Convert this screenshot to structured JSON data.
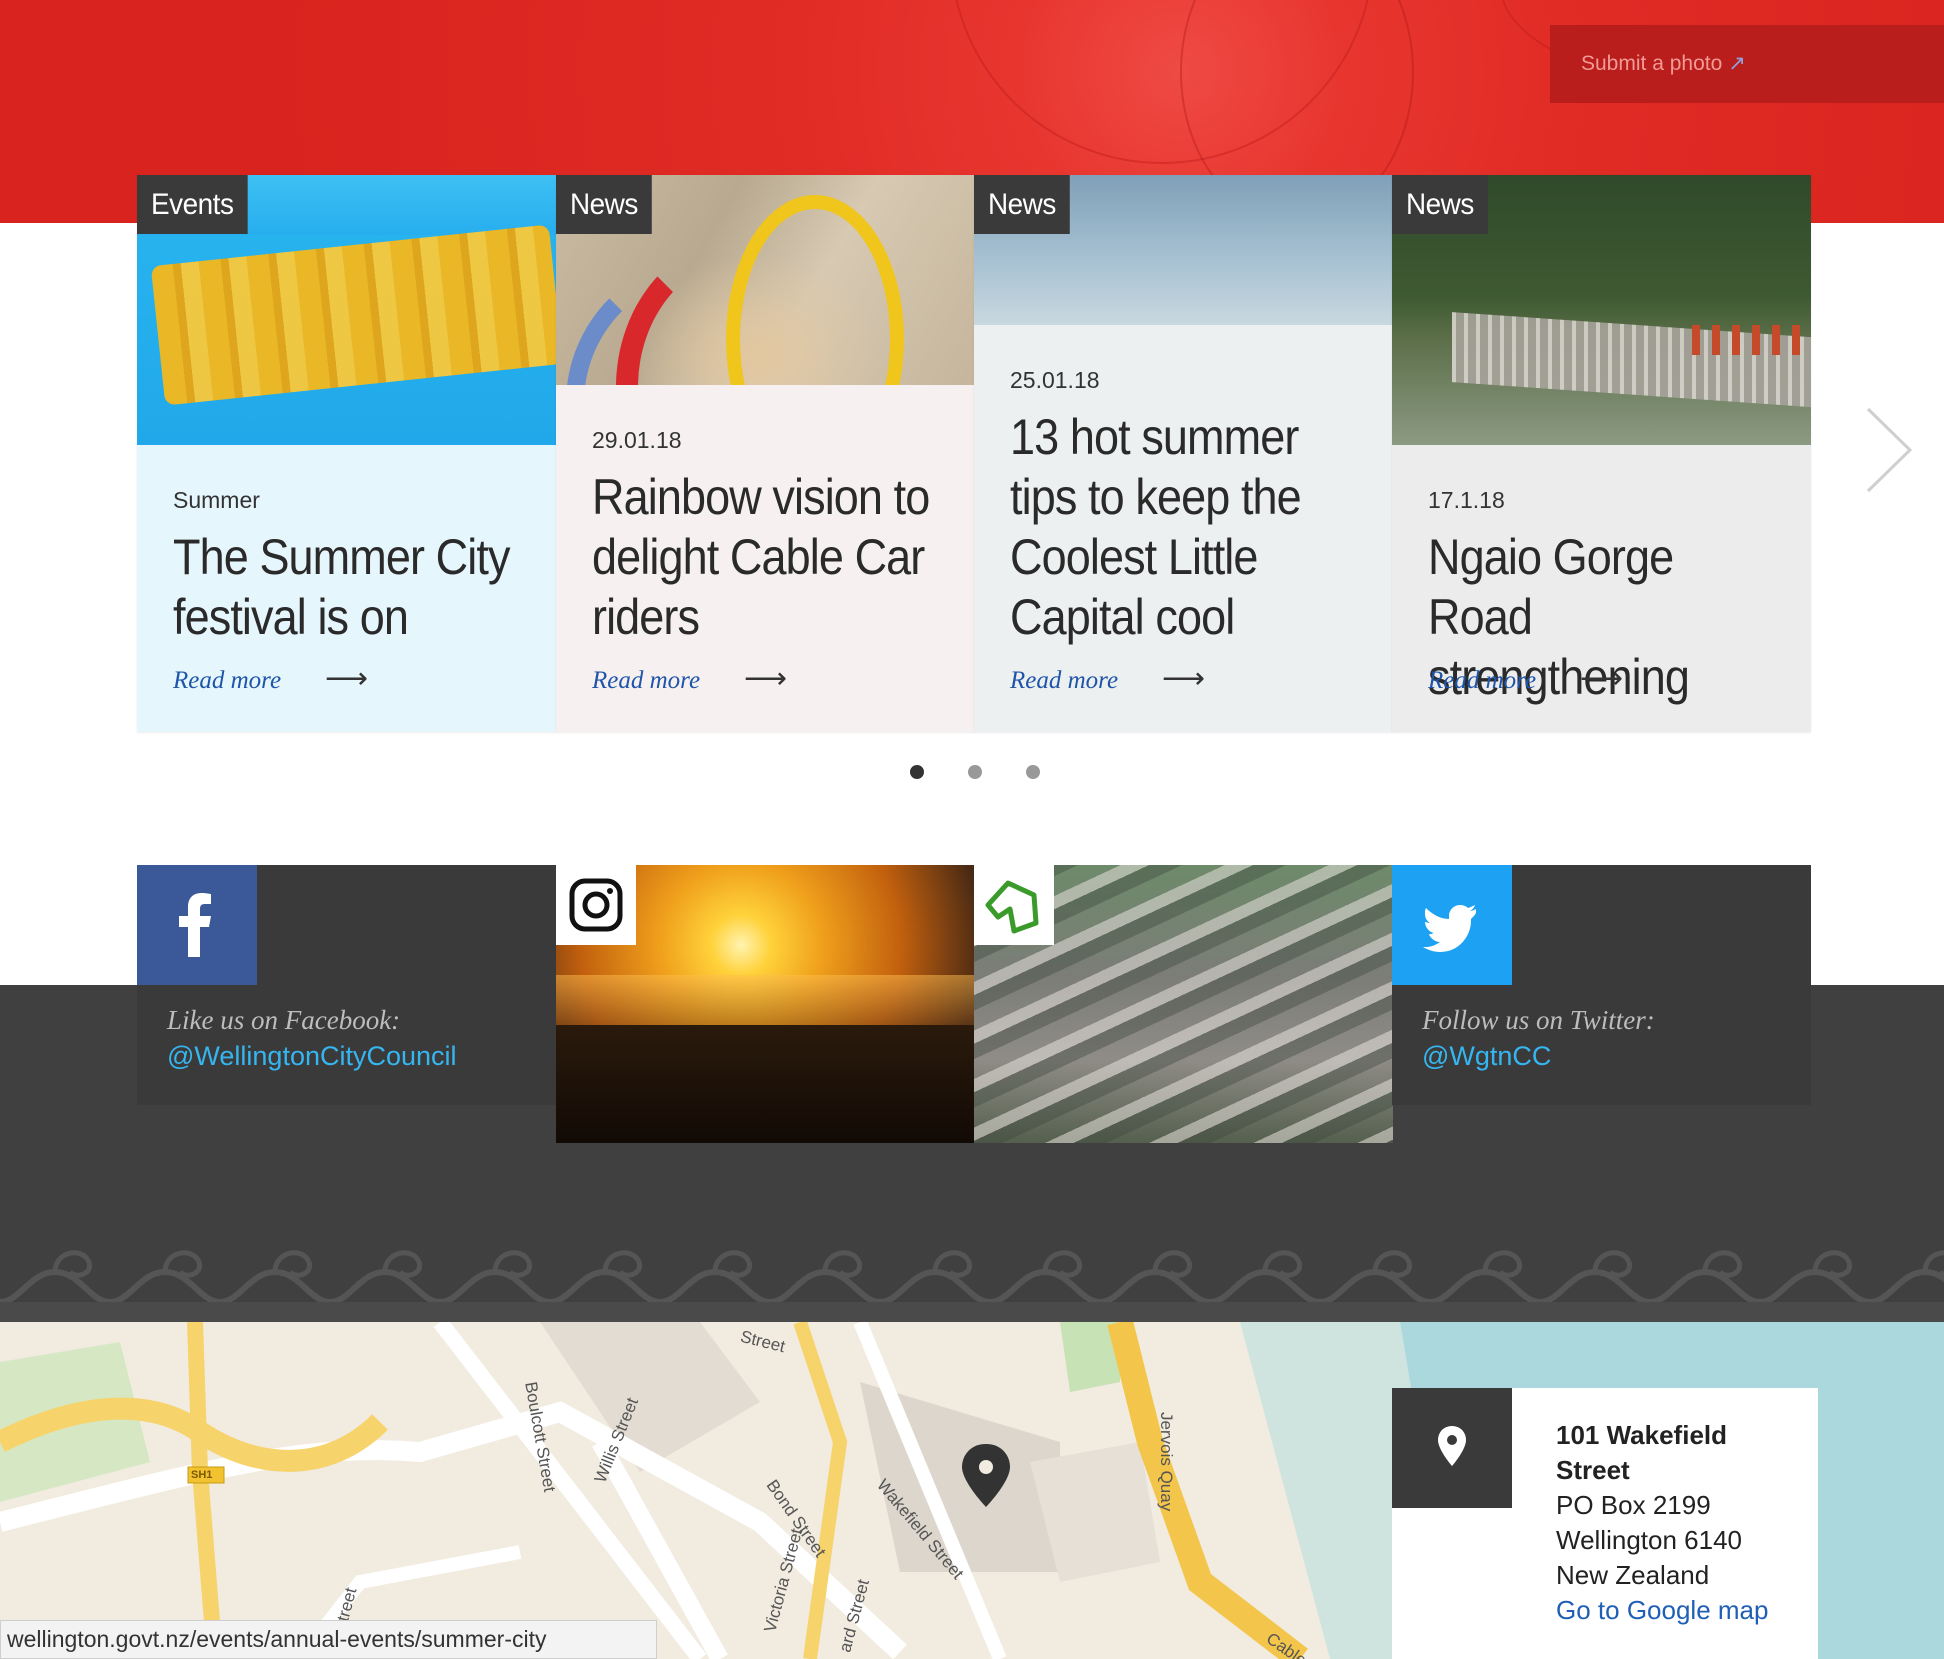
{
  "header": {
    "submit_photo_label": "Submit a photo",
    "external_icon": "external-link-icon"
  },
  "carousel": {
    "cards": [
      {
        "tag": "Events",
        "date": "Summer",
        "title": "The Summer City festival is on",
        "read_more": "Read more"
      },
      {
        "tag": "News",
        "date": "29.01.18",
        "title": "Rainbow vision to delight Cable Car riders",
        "read_more": "Read more"
      },
      {
        "tag": "News",
        "date": "25.01.18",
        "title": "13 hot summer tips to keep the Coolest Little Capital cool",
        "read_more": "Read more"
      },
      {
        "tag": "News",
        "date": "17.1.18",
        "title": "Ngaio Gorge Road strengthening",
        "read_more": "Read more"
      }
    ],
    "pagination": {
      "pages": 3,
      "active": 1
    },
    "next_icon": "chevron-right-icon"
  },
  "social": {
    "facebook": {
      "icon": "facebook-icon",
      "label": "Like us on Facebook:",
      "handle": "@WellingtonCityCouncil",
      "color": "#3b5998"
    },
    "instagram": {
      "icon": "instagram-icon"
    },
    "houses": {
      "icon": "house-logo-icon"
    },
    "twitter": {
      "icon": "twitter-icon",
      "label": "Follow us on Twitter:",
      "handle": "@WgtnCC",
      "color": "#1da1f2"
    }
  },
  "map": {
    "streets": [
      "Street",
      "Boulcott Street",
      "Willis Street",
      "Bond Street",
      "Victoria Street",
      "Wakefield Street",
      "Jervois Quay",
      "Street",
      "ard Street",
      "Cable St"
    ],
    "highway_badge": "SH1",
    "pin_icon": "map-pin-icon"
  },
  "address": {
    "line1": "101 Wakefield",
    "line2": "Street",
    "line3": "PO Box 2199",
    "line4": "Wellington 6140",
    "line5": "New Zealand",
    "map_link": "Go to Google map"
  },
  "status_bar": {
    "url": "wellington.govt.nz/events/annual-events/summer-city"
  },
  "colors": {
    "brand_red": "#e02a24",
    "dark": "#404040",
    "link_blue": "#1f55a8",
    "twitter_blue": "#35b6f0"
  }
}
